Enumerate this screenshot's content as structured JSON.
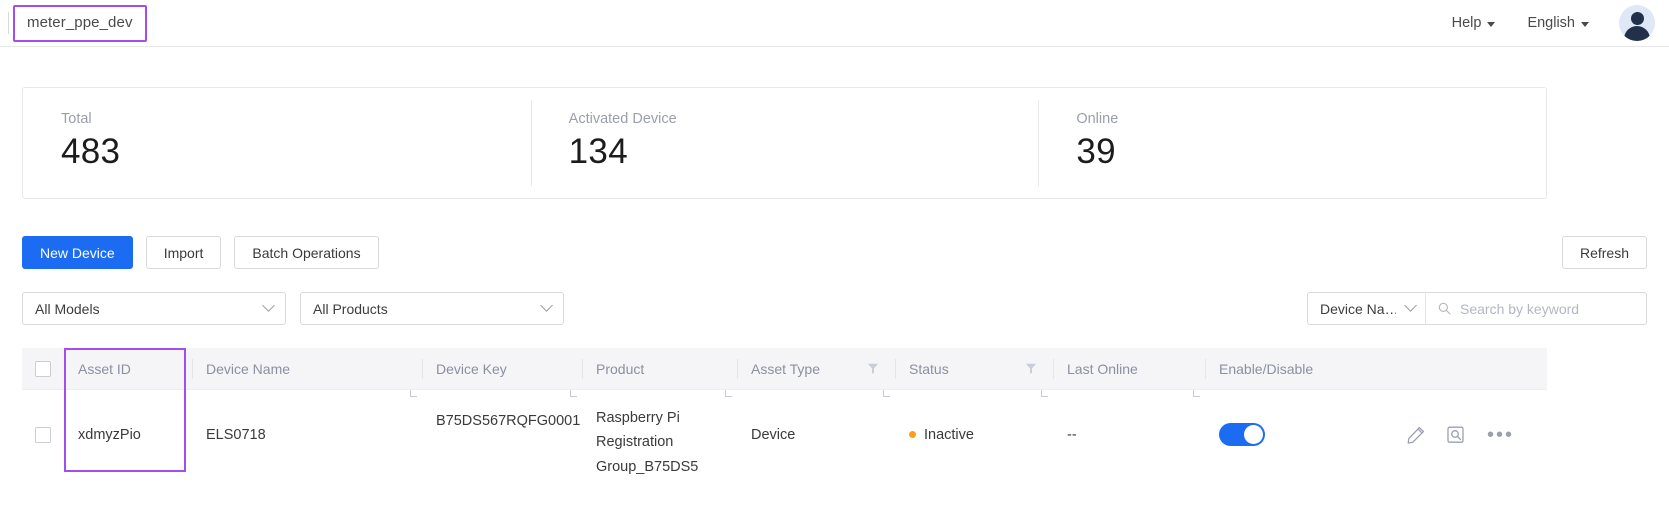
{
  "header": {
    "tenant_name": "meter_ppe_dev",
    "help_label": "Help",
    "language_label": "English"
  },
  "stats": [
    {
      "label": "Total",
      "value": "483"
    },
    {
      "label": "Activated Device",
      "value": "134"
    },
    {
      "label": "Online",
      "value": "39"
    }
  ],
  "toolbar": {
    "new_device_label": "New Device",
    "import_label": "Import",
    "batch_operations_label": "Batch Operations",
    "refresh_label": "Refresh"
  },
  "filters": {
    "models_label": "All Models",
    "products_label": "All Products",
    "search_field_label": "Device Na…",
    "search_placeholder": "Search by keyword",
    "search_value": ""
  },
  "table": {
    "columns": [
      {
        "label": "Asset ID",
        "filterable": false
      },
      {
        "label": "Device Name",
        "filterable": false
      },
      {
        "label": "Device Key",
        "filterable": false
      },
      {
        "label": "Product",
        "filterable": false
      },
      {
        "label": "Asset Type",
        "filterable": true
      },
      {
        "label": "Status",
        "filterable": true
      },
      {
        "label": "Last Online",
        "filterable": false
      },
      {
        "label": "Enable/Disable",
        "filterable": false
      }
    ],
    "rows": [
      {
        "asset_id": "xdmyzPio",
        "device_name": "ELS0718",
        "device_key": "B75DS567RQFG0001",
        "product": "Raspberry Pi Registration Group_B75DS5",
        "asset_type": "Device",
        "status": "Inactive",
        "status_color": "#fa9f1b",
        "last_online": "--",
        "enabled": true
      }
    ]
  },
  "colors": {
    "primary": "#1b6cf2",
    "highlight": "#a24df0",
    "status_inactive": "#fa9f1b"
  }
}
